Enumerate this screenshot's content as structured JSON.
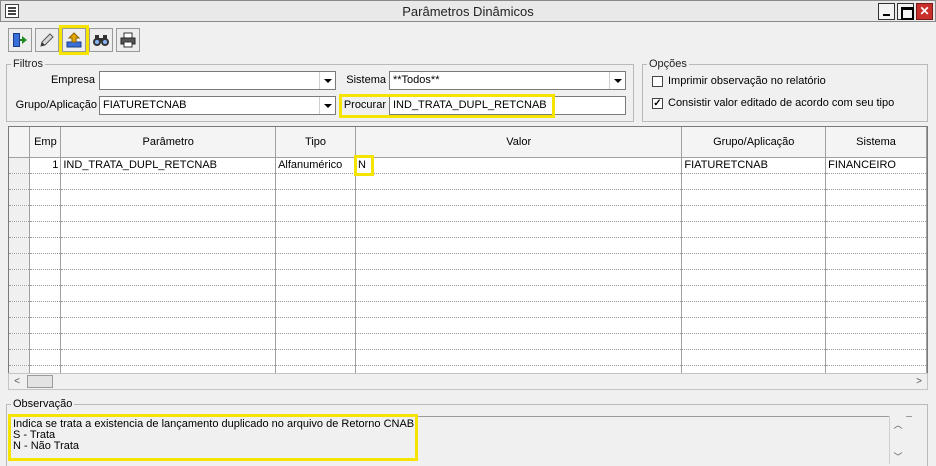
{
  "window": {
    "title": "Parâmetros Dinâmicos"
  },
  "toolbar": {
    "buttons": [
      {
        "icon": "exit-icon"
      },
      {
        "icon": "pencil-icon"
      },
      {
        "icon": "save-icon"
      },
      {
        "icon": "binoculars-icon"
      },
      {
        "icon": "printer-icon"
      }
    ]
  },
  "filtros": {
    "legend": "Filtros",
    "empresa_label": "Empresa",
    "empresa_value": "",
    "grupo_label": "Grupo/Aplicação",
    "grupo_value": "FIATURETCNAB",
    "sistema_label": "Sistema",
    "sistema_value": "**Todos**",
    "procurar_label": "Procurar",
    "procurar_value": "IND_TRATA_DUPL_RETCNAB"
  },
  "opcoes": {
    "legend": "Opções",
    "opt1_label": "Imprimir observação no relatório",
    "opt1_checked": false,
    "opt2_label": "Consistir valor editado de acordo com seu tipo",
    "opt2_checked": true
  },
  "grid": {
    "columns": [
      "Emp",
      "Parâmetro",
      "Tipo",
      "Valor",
      "Grupo/Aplicação",
      "Sistema"
    ],
    "rows": [
      [
        "1",
        "IND_TRATA_DUPL_RETCNAB",
        "Alfanumérico",
        "N",
        "FIATURETCNAB",
        "FINANCEIRO"
      ]
    ],
    "empty_rows": 13
  },
  "observacao": {
    "legend": "Observação",
    "line1": "Indica se trata a existencia de lançamento duplicado no arquivo de Retorno CNAB.",
    "line2": "S - Trata",
    "line3": "N - Não Trata"
  }
}
